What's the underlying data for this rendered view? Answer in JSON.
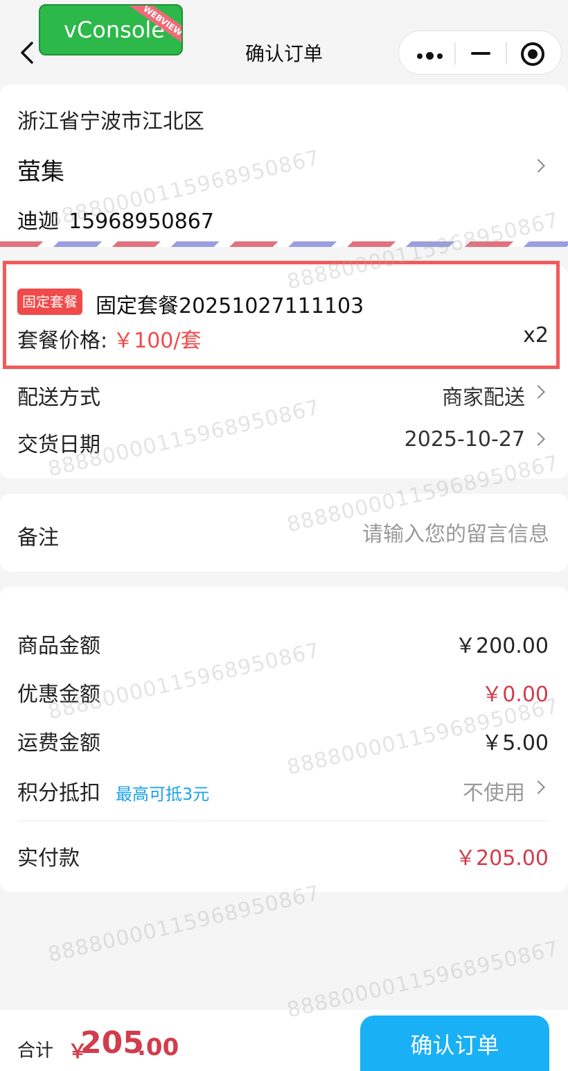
{
  "nav": {
    "title": "确认订单",
    "vconsole": {
      "label": "vConsole",
      "ribbon": "WEBVIEW"
    }
  },
  "address": {
    "region": "浙江省宁波市江北区",
    "name": "萤集",
    "contact_name": "迪迦",
    "phone": "15968950867"
  },
  "order": {
    "tag": "固定套餐",
    "package_name": "固定套餐20251027111103",
    "price_label": "套餐价格:",
    "price_value": "￥100/套",
    "quantity": "x2",
    "delivery_label": "配送方式",
    "delivery_value": "商家配送",
    "date_label": "交货日期",
    "date_value": "2025-10-27"
  },
  "remark": {
    "label": "备注",
    "placeholder": "请输入您的留言信息"
  },
  "summary": {
    "goods_label": "商品金额",
    "goods_value": "￥200.00",
    "discount_label": "优惠金额",
    "discount_value": "￥0.00",
    "shipping_label": "运费金额",
    "shipping_value": "￥5.00",
    "points_label": "积分抵扣",
    "points_hint": "最高可抵3元",
    "points_value": "不使用",
    "paid_label": "实付款",
    "paid_value": "￥205.00"
  },
  "bottom": {
    "total_label": "合计",
    "currency": "￥",
    "total_int": "205",
    "total_dec": ".00",
    "confirm_label": "确认订单"
  },
  "watermark": "88880000115968950867",
  "colors": {
    "accent_red": "#d23c4c",
    "tag_red": "#f04a4a",
    "confirm_blue": "#1ab0f5",
    "hint_blue": "#1aa3e8",
    "vconsole_green": "#2db84a"
  }
}
